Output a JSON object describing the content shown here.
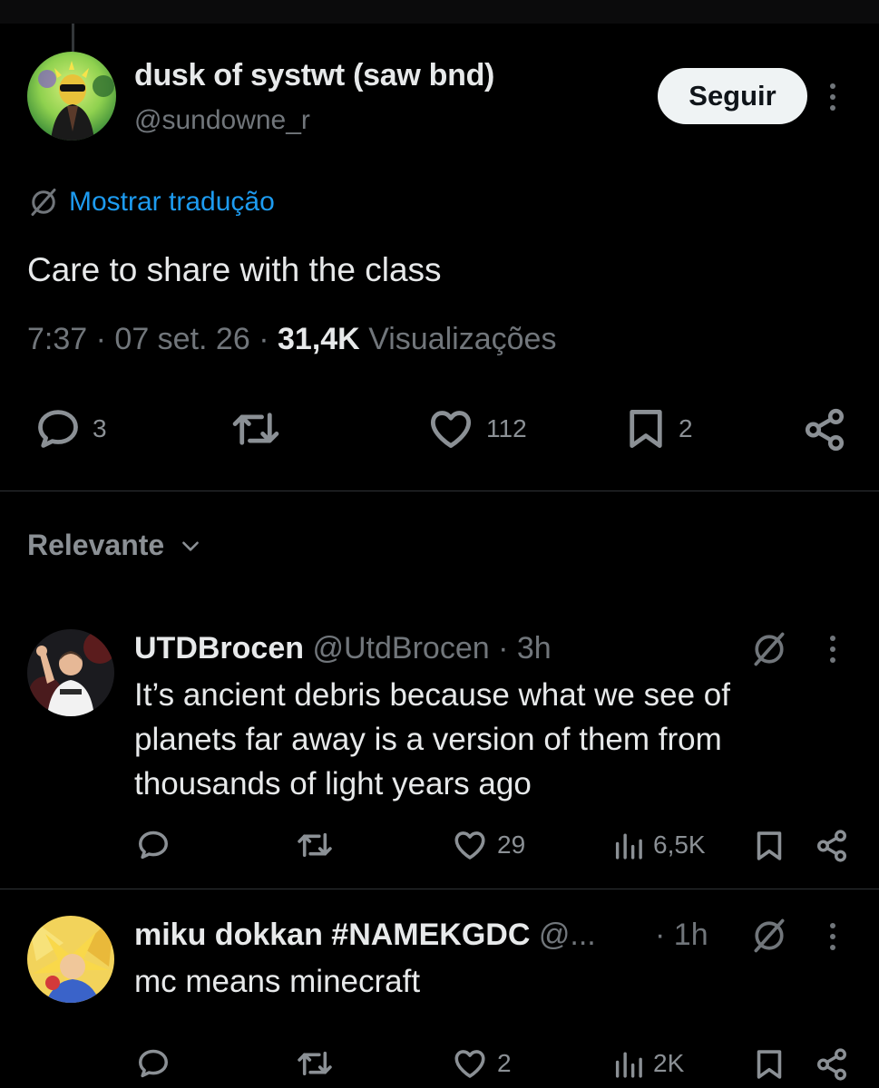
{
  "main_tweet": {
    "display_name": "dusk of systwt (saw bnd)",
    "handle": "@sundowne_r",
    "follow_label": "Seguir",
    "translate_label": "Mostrar tradução",
    "text": "Care to share with the class",
    "time": "7:37",
    "date": "07 set. 26",
    "views_count": "31,4K",
    "views_label": "Visualizações",
    "actions": {
      "replies": "3",
      "likes": "112",
      "bookmarks": "2"
    }
  },
  "sort": {
    "label": "Relevante"
  },
  "replies": [
    {
      "display_name": "UTDBrocen",
      "handle": "@UtdBrocen",
      "time": "3h",
      "text": "It’s ancient debris because what we see of planets far away is a version of them from thousands of light years ago",
      "likes": "29",
      "views": "6,5K"
    },
    {
      "display_name": "miku dokkan #NAMEKGDC",
      "handle": "@...",
      "time": "1h",
      "text": "mc means minecraft",
      "likes": "2",
      "views": "2K"
    }
  ],
  "colors": {
    "background": "#000000",
    "text": "#e7e9ea",
    "muted": "#71767b",
    "link": "#1d9bf0",
    "follow_bg": "#eff3f4"
  }
}
